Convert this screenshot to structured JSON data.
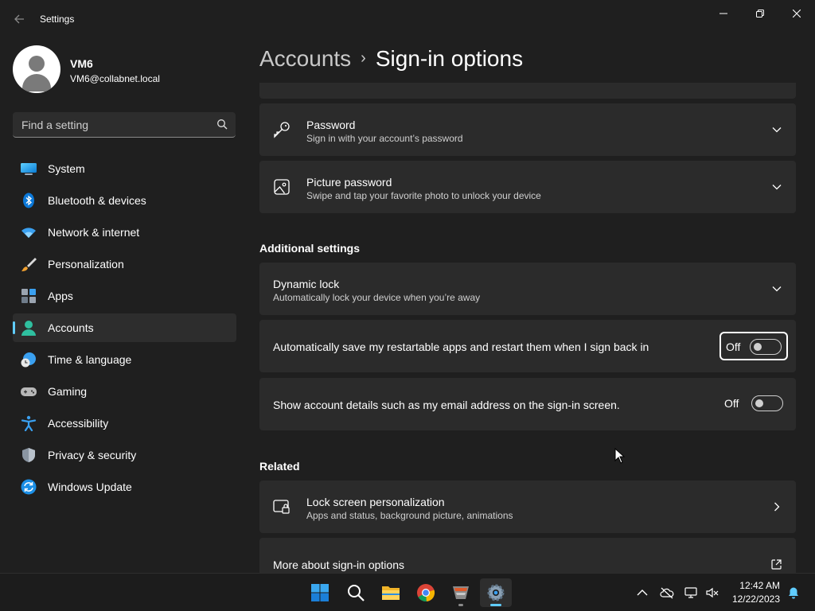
{
  "window": {
    "title": "Settings",
    "back_icon": "back-arrow-icon",
    "minimize_icon": "minimize-icon",
    "maximize_icon": "restore-icon",
    "close_icon": "close-icon"
  },
  "profile": {
    "name": "VM6",
    "email": "VM6@collabnet.local"
  },
  "search": {
    "placeholder": "Find a setting"
  },
  "sidebar": {
    "items": [
      {
        "label": "System",
        "icon": "monitor-icon"
      },
      {
        "label": "Bluetooth & devices",
        "icon": "bluetooth-icon"
      },
      {
        "label": "Network & internet",
        "icon": "wifi-icon"
      },
      {
        "label": "Personalization",
        "icon": "brush-icon"
      },
      {
        "label": "Apps",
        "icon": "apps-icon"
      },
      {
        "label": "Accounts",
        "icon": "person-icon",
        "active": true
      },
      {
        "label": "Time & language",
        "icon": "globe-clock-icon"
      },
      {
        "label": "Gaming",
        "icon": "gamepad-icon"
      },
      {
        "label": "Accessibility",
        "icon": "accessibility-icon"
      },
      {
        "label": "Privacy & security",
        "icon": "shield-icon"
      },
      {
        "label": "Windows Update",
        "icon": "update-icon"
      }
    ]
  },
  "header": {
    "parent": "Accounts",
    "separator": "›",
    "current": "Sign-in options"
  },
  "content": {
    "password": {
      "title": "Password",
      "subtitle": "Sign in with your account’s password"
    },
    "picture_password": {
      "title": "Picture password",
      "subtitle": "Swipe and tap your favorite photo to unlock your device"
    },
    "additional_settings_heading": "Additional settings",
    "dynamic_lock": {
      "title": "Dynamic lock",
      "subtitle": "Automatically lock your device when you’re away"
    },
    "restart_apps": {
      "label": "Automatically save my restartable apps and restart them when I sign back in",
      "state": "Off"
    },
    "account_details": {
      "label": "Show account details such as my email address on the sign-in screen.",
      "state": "Off"
    },
    "related_heading": "Related",
    "lock_screen": {
      "title": "Lock screen personalization",
      "subtitle": "Apps and status, background picture, animations"
    },
    "more_about": {
      "title": "More about sign-in options"
    }
  },
  "taskbar": {
    "apps": [
      "start-icon",
      "search-icon",
      "file-explorer-icon",
      "chrome-icon",
      "app-icon",
      "settings-icon"
    ],
    "tray": [
      "chevron-up-icon",
      "cloud-off-icon",
      "network-icon",
      "volume-muted-icon"
    ],
    "time": "12:42 AM",
    "date": "12/22/2023",
    "notification_icon": "bell-icon"
  },
  "colors": {
    "accent": "#60cdff",
    "background": "#1f1f1f",
    "card": "#2b2b2b"
  }
}
